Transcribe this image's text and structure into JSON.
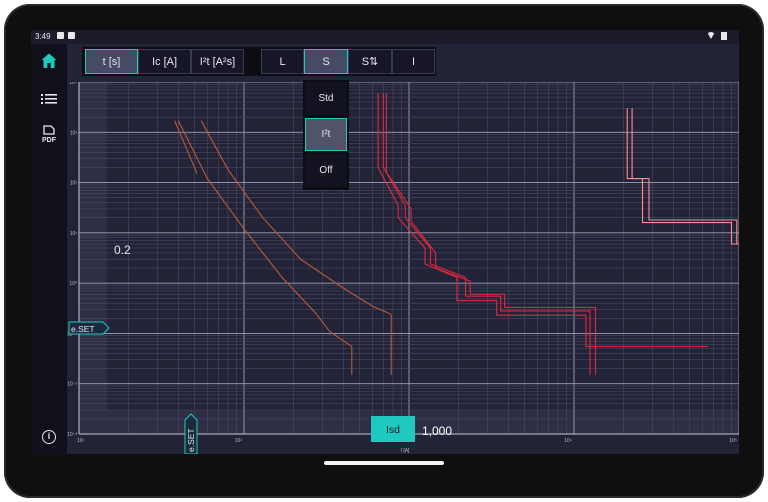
{
  "status_bar": {
    "time": "3:49"
  },
  "sidebar": {
    "items": [
      {
        "name": "home",
        "icon": "home-icon",
        "active": true
      },
      {
        "name": "list",
        "icon": "list-icon"
      },
      {
        "name": "pdf",
        "icon": "pdf-icon",
        "label": "PDF"
      },
      {
        "name": "info",
        "icon": "info-icon",
        "label": "i"
      }
    ]
  },
  "toolbar": {
    "curve_types": [
      {
        "label": "t [s]",
        "active": true
      },
      {
        "label": "Ic [A]",
        "active": false
      },
      {
        "label": "I²t [A²s]",
        "active": false
      }
    ],
    "protections": [
      {
        "label": "L",
        "active": false
      },
      {
        "label": "S",
        "active": true
      },
      {
        "label": "S⇅",
        "active": false
      },
      {
        "label": "I",
        "active": false
      }
    ]
  },
  "s_dropdown": {
    "options": [
      {
        "label": "Std",
        "active": false
      },
      {
        "label": "I²t",
        "active": true
      },
      {
        "label": "Off",
        "active": false
      }
    ]
  },
  "chart": {
    "x_unit": "I [A]",
    "y_tick_labels": [
      "10⁴",
      "10³",
      "10²",
      "10¹",
      "10⁰",
      "10⁻¹",
      "10⁻²",
      "10⁻³"
    ],
    "x_tick_labels": [
      "10¹",
      "10²",
      "10³",
      "10⁴",
      "10⁵"
    ],
    "time_value": "0.2",
    "eset_label": "e.SET",
    "eset_x_label": "e.SET",
    "isd_button": "Isd",
    "isd_value": "1,000"
  },
  "colors": {
    "accent": "#20c9c0",
    "curve_red": "#e0283c",
    "curve_pink": "#ff8c9a",
    "curve_orange": "#b85a38",
    "background": "#232338"
  },
  "chart_data": {
    "type": "line",
    "x_scale": "log",
    "y_scale": "log",
    "xlim": [
      10,
      100000
    ],
    "ylim": [
      0.001,
      10000
    ],
    "x_ticks": [
      10,
      100,
      1000,
      10000,
      100000
    ],
    "y_ticks": [
      10000,
      1000,
      100,
      10,
      1,
      0.1,
      0.01,
      0.001
    ],
    "grid": true,
    "series": [
      {
        "color": "#e0283c",
        "values": [
          [
            700,
            6000
          ],
          [
            700,
            200
          ],
          [
            950,
            35
          ],
          [
            950,
            20
          ],
          [
            1350,
            5
          ],
          [
            1350,
            2.4
          ],
          [
            2200,
            1.3
          ],
          [
            2200,
            0.55
          ],
          [
            3600,
            0.55
          ],
          [
            3600,
            0.28
          ],
          [
            12500,
            0.28
          ],
          [
            12500,
            0.015
          ]
        ]
      },
      {
        "color": "#e0283c",
        "values": [
          [
            650,
            6000
          ],
          [
            650,
            200
          ],
          [
            860,
            35
          ],
          [
            860,
            20
          ],
          [
            1250,
            5
          ],
          [
            1250,
            2.4
          ],
          [
            1950,
            1.3
          ],
          [
            1950,
            0.45
          ],
          [
            3400,
            0.45
          ],
          [
            3400,
            0.23
          ],
          [
            11800,
            0.23
          ],
          [
            11800,
            0.055
          ],
          [
            65000,
            0.055
          ]
        ]
      },
      {
        "color": "#e0283c",
        "values": [
          [
            730,
            6000
          ],
          [
            730,
            160
          ],
          [
            1030,
            30
          ],
          [
            1030,
            17
          ],
          [
            1450,
            4
          ],
          [
            1450,
            2.0
          ],
          [
            2350,
            1.1
          ],
          [
            2350,
            0.6
          ],
          [
            3800,
            0.6
          ],
          [
            3800,
            0.33
          ],
          [
            13500,
            0.33
          ],
          [
            13500,
            0.015
          ]
        ]
      },
      {
        "color": "#ff8c9a",
        "values": [
          [
            21000,
            3000
          ],
          [
            21000,
            120
          ],
          [
            26000,
            120
          ],
          [
            26000,
            16
          ],
          [
            90000,
            16
          ],
          [
            90000,
            6
          ],
          [
            600000,
            6
          ]
        ]
      },
      {
        "color": "#ff8c9a",
        "values": [
          [
            22500,
            3000
          ],
          [
            22500,
            120
          ],
          [
            28500,
            120
          ],
          [
            28500,
            18
          ],
          [
            97000,
            18
          ],
          [
            97000,
            6
          ]
        ]
      },
      {
        "color": "#b85a38",
        "values": [
          [
            40,
            1700
          ],
          [
            60,
            120
          ],
          [
            100,
            12
          ],
          [
            170,
            1.3
          ],
          [
            270,
            0.26
          ],
          [
            330,
            0.11
          ],
          [
            450,
            0.055
          ],
          [
            450,
            0.015
          ]
        ]
      },
      {
        "color": "#b85a38",
        "values": [
          [
            55,
            1700
          ],
          [
            80,
            180
          ],
          [
            130,
            20
          ],
          [
            220,
            3
          ],
          [
            400,
            0.8
          ],
          [
            600,
            0.35
          ],
          [
            780,
            0.24
          ],
          [
            780,
            0.015
          ]
        ]
      },
      {
        "color": "#b85a38",
        "values": [
          [
            38,
            1700
          ],
          [
            52,
            150
          ]
        ]
      }
    ]
  }
}
